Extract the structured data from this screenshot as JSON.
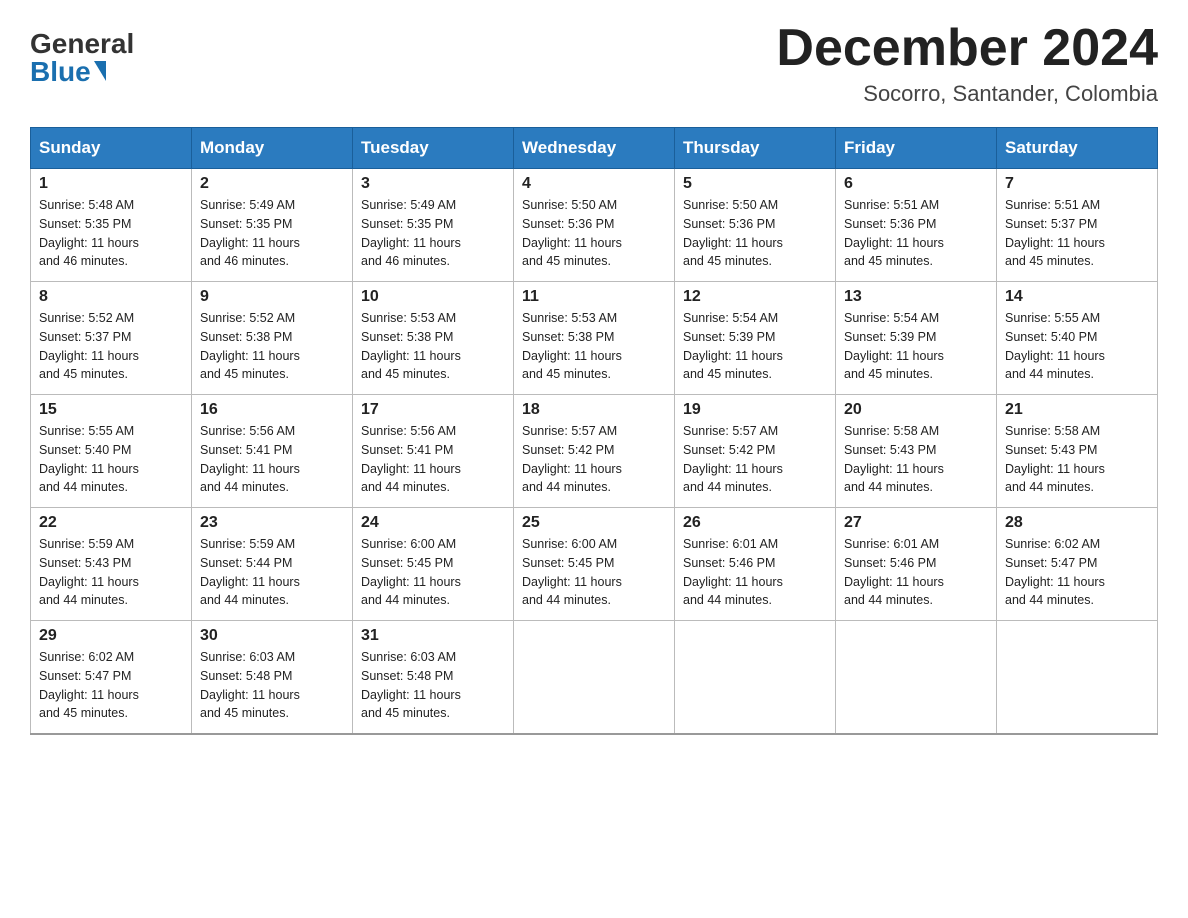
{
  "header": {
    "logo_general": "General",
    "logo_blue": "Blue",
    "month_title": "December 2024",
    "location": "Socorro, Santander, Colombia"
  },
  "weekdays": [
    "Sunday",
    "Monday",
    "Tuesday",
    "Wednesday",
    "Thursday",
    "Friday",
    "Saturday"
  ],
  "weeks": [
    [
      {
        "day": "1",
        "sunrise": "5:48 AM",
        "sunset": "5:35 PM",
        "daylight": "11 hours and 46 minutes."
      },
      {
        "day": "2",
        "sunrise": "5:49 AM",
        "sunset": "5:35 PM",
        "daylight": "11 hours and 46 minutes."
      },
      {
        "day": "3",
        "sunrise": "5:49 AM",
        "sunset": "5:35 PM",
        "daylight": "11 hours and 46 minutes."
      },
      {
        "day": "4",
        "sunrise": "5:50 AM",
        "sunset": "5:36 PM",
        "daylight": "11 hours and 45 minutes."
      },
      {
        "day": "5",
        "sunrise": "5:50 AM",
        "sunset": "5:36 PM",
        "daylight": "11 hours and 45 minutes."
      },
      {
        "day": "6",
        "sunrise": "5:51 AM",
        "sunset": "5:36 PM",
        "daylight": "11 hours and 45 minutes."
      },
      {
        "day": "7",
        "sunrise": "5:51 AM",
        "sunset": "5:37 PM",
        "daylight": "11 hours and 45 minutes."
      }
    ],
    [
      {
        "day": "8",
        "sunrise": "5:52 AM",
        "sunset": "5:37 PM",
        "daylight": "11 hours and 45 minutes."
      },
      {
        "day": "9",
        "sunrise": "5:52 AM",
        "sunset": "5:38 PM",
        "daylight": "11 hours and 45 minutes."
      },
      {
        "day": "10",
        "sunrise": "5:53 AM",
        "sunset": "5:38 PM",
        "daylight": "11 hours and 45 minutes."
      },
      {
        "day": "11",
        "sunrise": "5:53 AM",
        "sunset": "5:38 PM",
        "daylight": "11 hours and 45 minutes."
      },
      {
        "day": "12",
        "sunrise": "5:54 AM",
        "sunset": "5:39 PM",
        "daylight": "11 hours and 45 minutes."
      },
      {
        "day": "13",
        "sunrise": "5:54 AM",
        "sunset": "5:39 PM",
        "daylight": "11 hours and 45 minutes."
      },
      {
        "day": "14",
        "sunrise": "5:55 AM",
        "sunset": "5:40 PM",
        "daylight": "11 hours and 44 minutes."
      }
    ],
    [
      {
        "day": "15",
        "sunrise": "5:55 AM",
        "sunset": "5:40 PM",
        "daylight": "11 hours and 44 minutes."
      },
      {
        "day": "16",
        "sunrise": "5:56 AM",
        "sunset": "5:41 PM",
        "daylight": "11 hours and 44 minutes."
      },
      {
        "day": "17",
        "sunrise": "5:56 AM",
        "sunset": "5:41 PM",
        "daylight": "11 hours and 44 minutes."
      },
      {
        "day": "18",
        "sunrise": "5:57 AM",
        "sunset": "5:42 PM",
        "daylight": "11 hours and 44 minutes."
      },
      {
        "day": "19",
        "sunrise": "5:57 AM",
        "sunset": "5:42 PM",
        "daylight": "11 hours and 44 minutes."
      },
      {
        "day": "20",
        "sunrise": "5:58 AM",
        "sunset": "5:43 PM",
        "daylight": "11 hours and 44 minutes."
      },
      {
        "day": "21",
        "sunrise": "5:58 AM",
        "sunset": "5:43 PM",
        "daylight": "11 hours and 44 minutes."
      }
    ],
    [
      {
        "day": "22",
        "sunrise": "5:59 AM",
        "sunset": "5:43 PM",
        "daylight": "11 hours and 44 minutes."
      },
      {
        "day": "23",
        "sunrise": "5:59 AM",
        "sunset": "5:44 PM",
        "daylight": "11 hours and 44 minutes."
      },
      {
        "day": "24",
        "sunrise": "6:00 AM",
        "sunset": "5:45 PM",
        "daylight": "11 hours and 44 minutes."
      },
      {
        "day": "25",
        "sunrise": "6:00 AM",
        "sunset": "5:45 PM",
        "daylight": "11 hours and 44 minutes."
      },
      {
        "day": "26",
        "sunrise": "6:01 AM",
        "sunset": "5:46 PM",
        "daylight": "11 hours and 44 minutes."
      },
      {
        "day": "27",
        "sunrise": "6:01 AM",
        "sunset": "5:46 PM",
        "daylight": "11 hours and 44 minutes."
      },
      {
        "day": "28",
        "sunrise": "6:02 AM",
        "sunset": "5:47 PM",
        "daylight": "11 hours and 44 minutes."
      }
    ],
    [
      {
        "day": "29",
        "sunrise": "6:02 AM",
        "sunset": "5:47 PM",
        "daylight": "11 hours and 45 minutes."
      },
      {
        "day": "30",
        "sunrise": "6:03 AM",
        "sunset": "5:48 PM",
        "daylight": "11 hours and 45 minutes."
      },
      {
        "day": "31",
        "sunrise": "6:03 AM",
        "sunset": "5:48 PM",
        "daylight": "11 hours and 45 minutes."
      },
      null,
      null,
      null,
      null
    ]
  ],
  "labels": {
    "sunrise": "Sunrise:",
    "sunset": "Sunset:",
    "daylight": "Daylight:"
  }
}
